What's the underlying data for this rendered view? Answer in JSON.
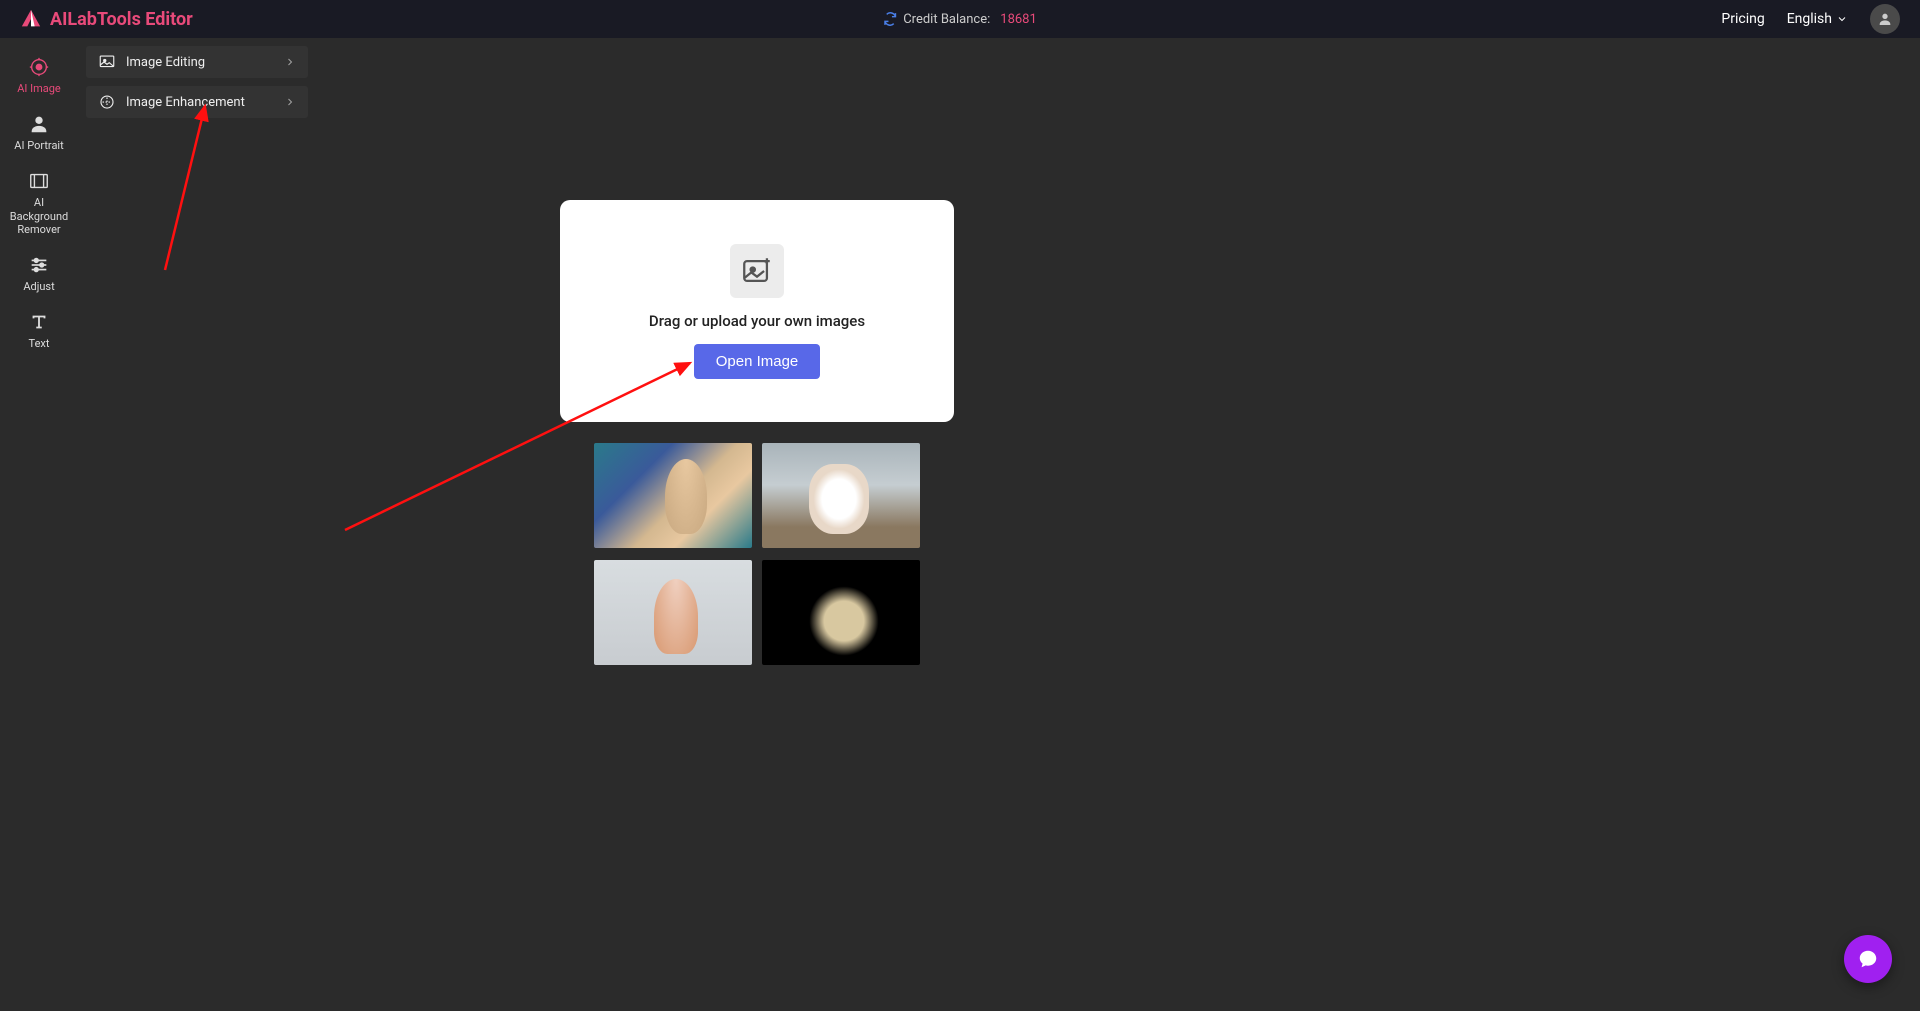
{
  "header": {
    "app_name": "AILabTools Editor",
    "credit_label": "Credit Balance:",
    "credit_value": "18681",
    "pricing": "Pricing",
    "language": "English"
  },
  "sidebar": {
    "items": [
      {
        "label": "AI Image"
      },
      {
        "label": "AI Portrait"
      },
      {
        "label": "AI Background Remover"
      },
      {
        "label": "Adjust"
      },
      {
        "label": "Text"
      }
    ]
  },
  "submenu": {
    "items": [
      {
        "label": "Image Editing"
      },
      {
        "label": "Image Enhancement"
      }
    ]
  },
  "upload": {
    "prompt": "Drag or upload your own images",
    "button": "Open Image"
  }
}
